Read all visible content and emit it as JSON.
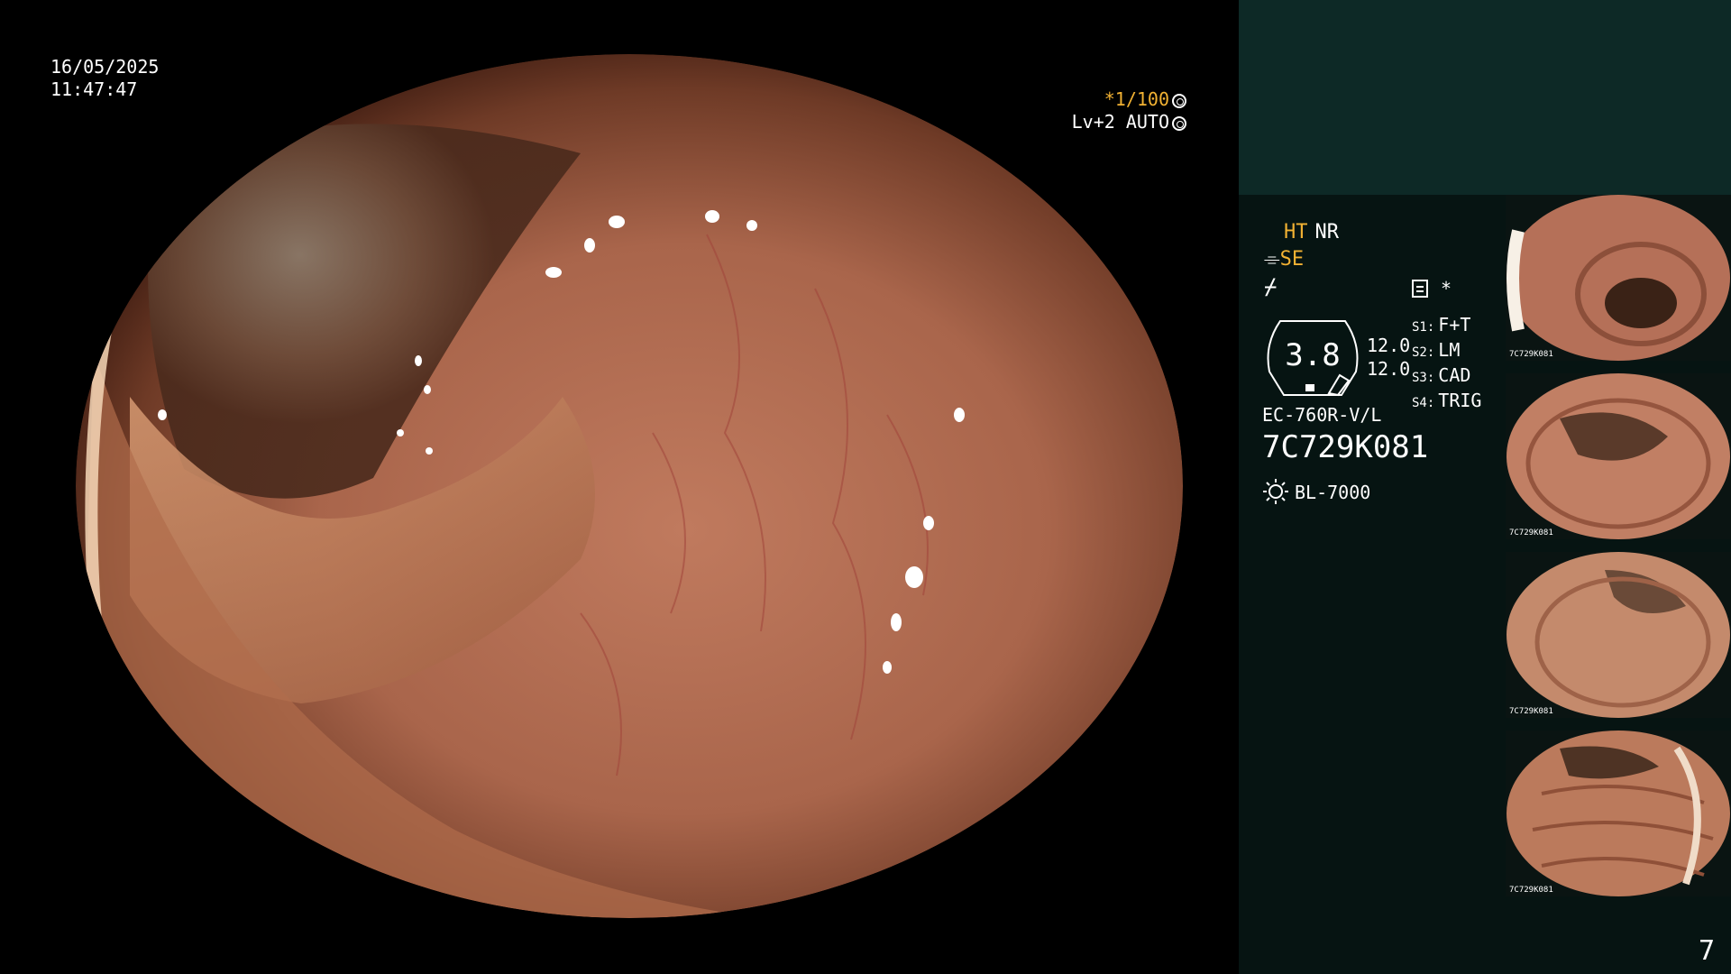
{
  "overlay": {
    "date": "16/05/2025",
    "time": "11:47:47",
    "shutter": "*1/100",
    "level": "Lv+2 AUTO"
  },
  "panel": {
    "ht": "HT",
    "nr": "NR",
    "se": "SE",
    "structure_symbol": "⌿",
    "menu_symbol": "*",
    "zoom": "3.8",
    "zoom_levels": [
      "12.0",
      "12.0"
    ],
    "switches": [
      {
        "key": "S1:",
        "label": "F+T"
      },
      {
        "key": "S2:",
        "label": "LM"
      },
      {
        "key": "S3:",
        "label": "CAD"
      },
      {
        "key": "S4:",
        "label": "TRIG"
      }
    ],
    "scope_model": "EC-760R-V/L",
    "scope_serial": "7C729K081",
    "light_source": "BL-7000"
  },
  "thumbnails": [
    {
      "caption": "7C729K081"
    },
    {
      "caption": "7C729K081"
    },
    {
      "caption": "7C729K081"
    },
    {
      "caption": "7C729K081"
    }
  ],
  "page_number": "7",
  "colors": {
    "accent": "#f2b233",
    "panel_bg": "#061412",
    "panel_top": "#0d2926",
    "mucosa": "#b9735a"
  }
}
